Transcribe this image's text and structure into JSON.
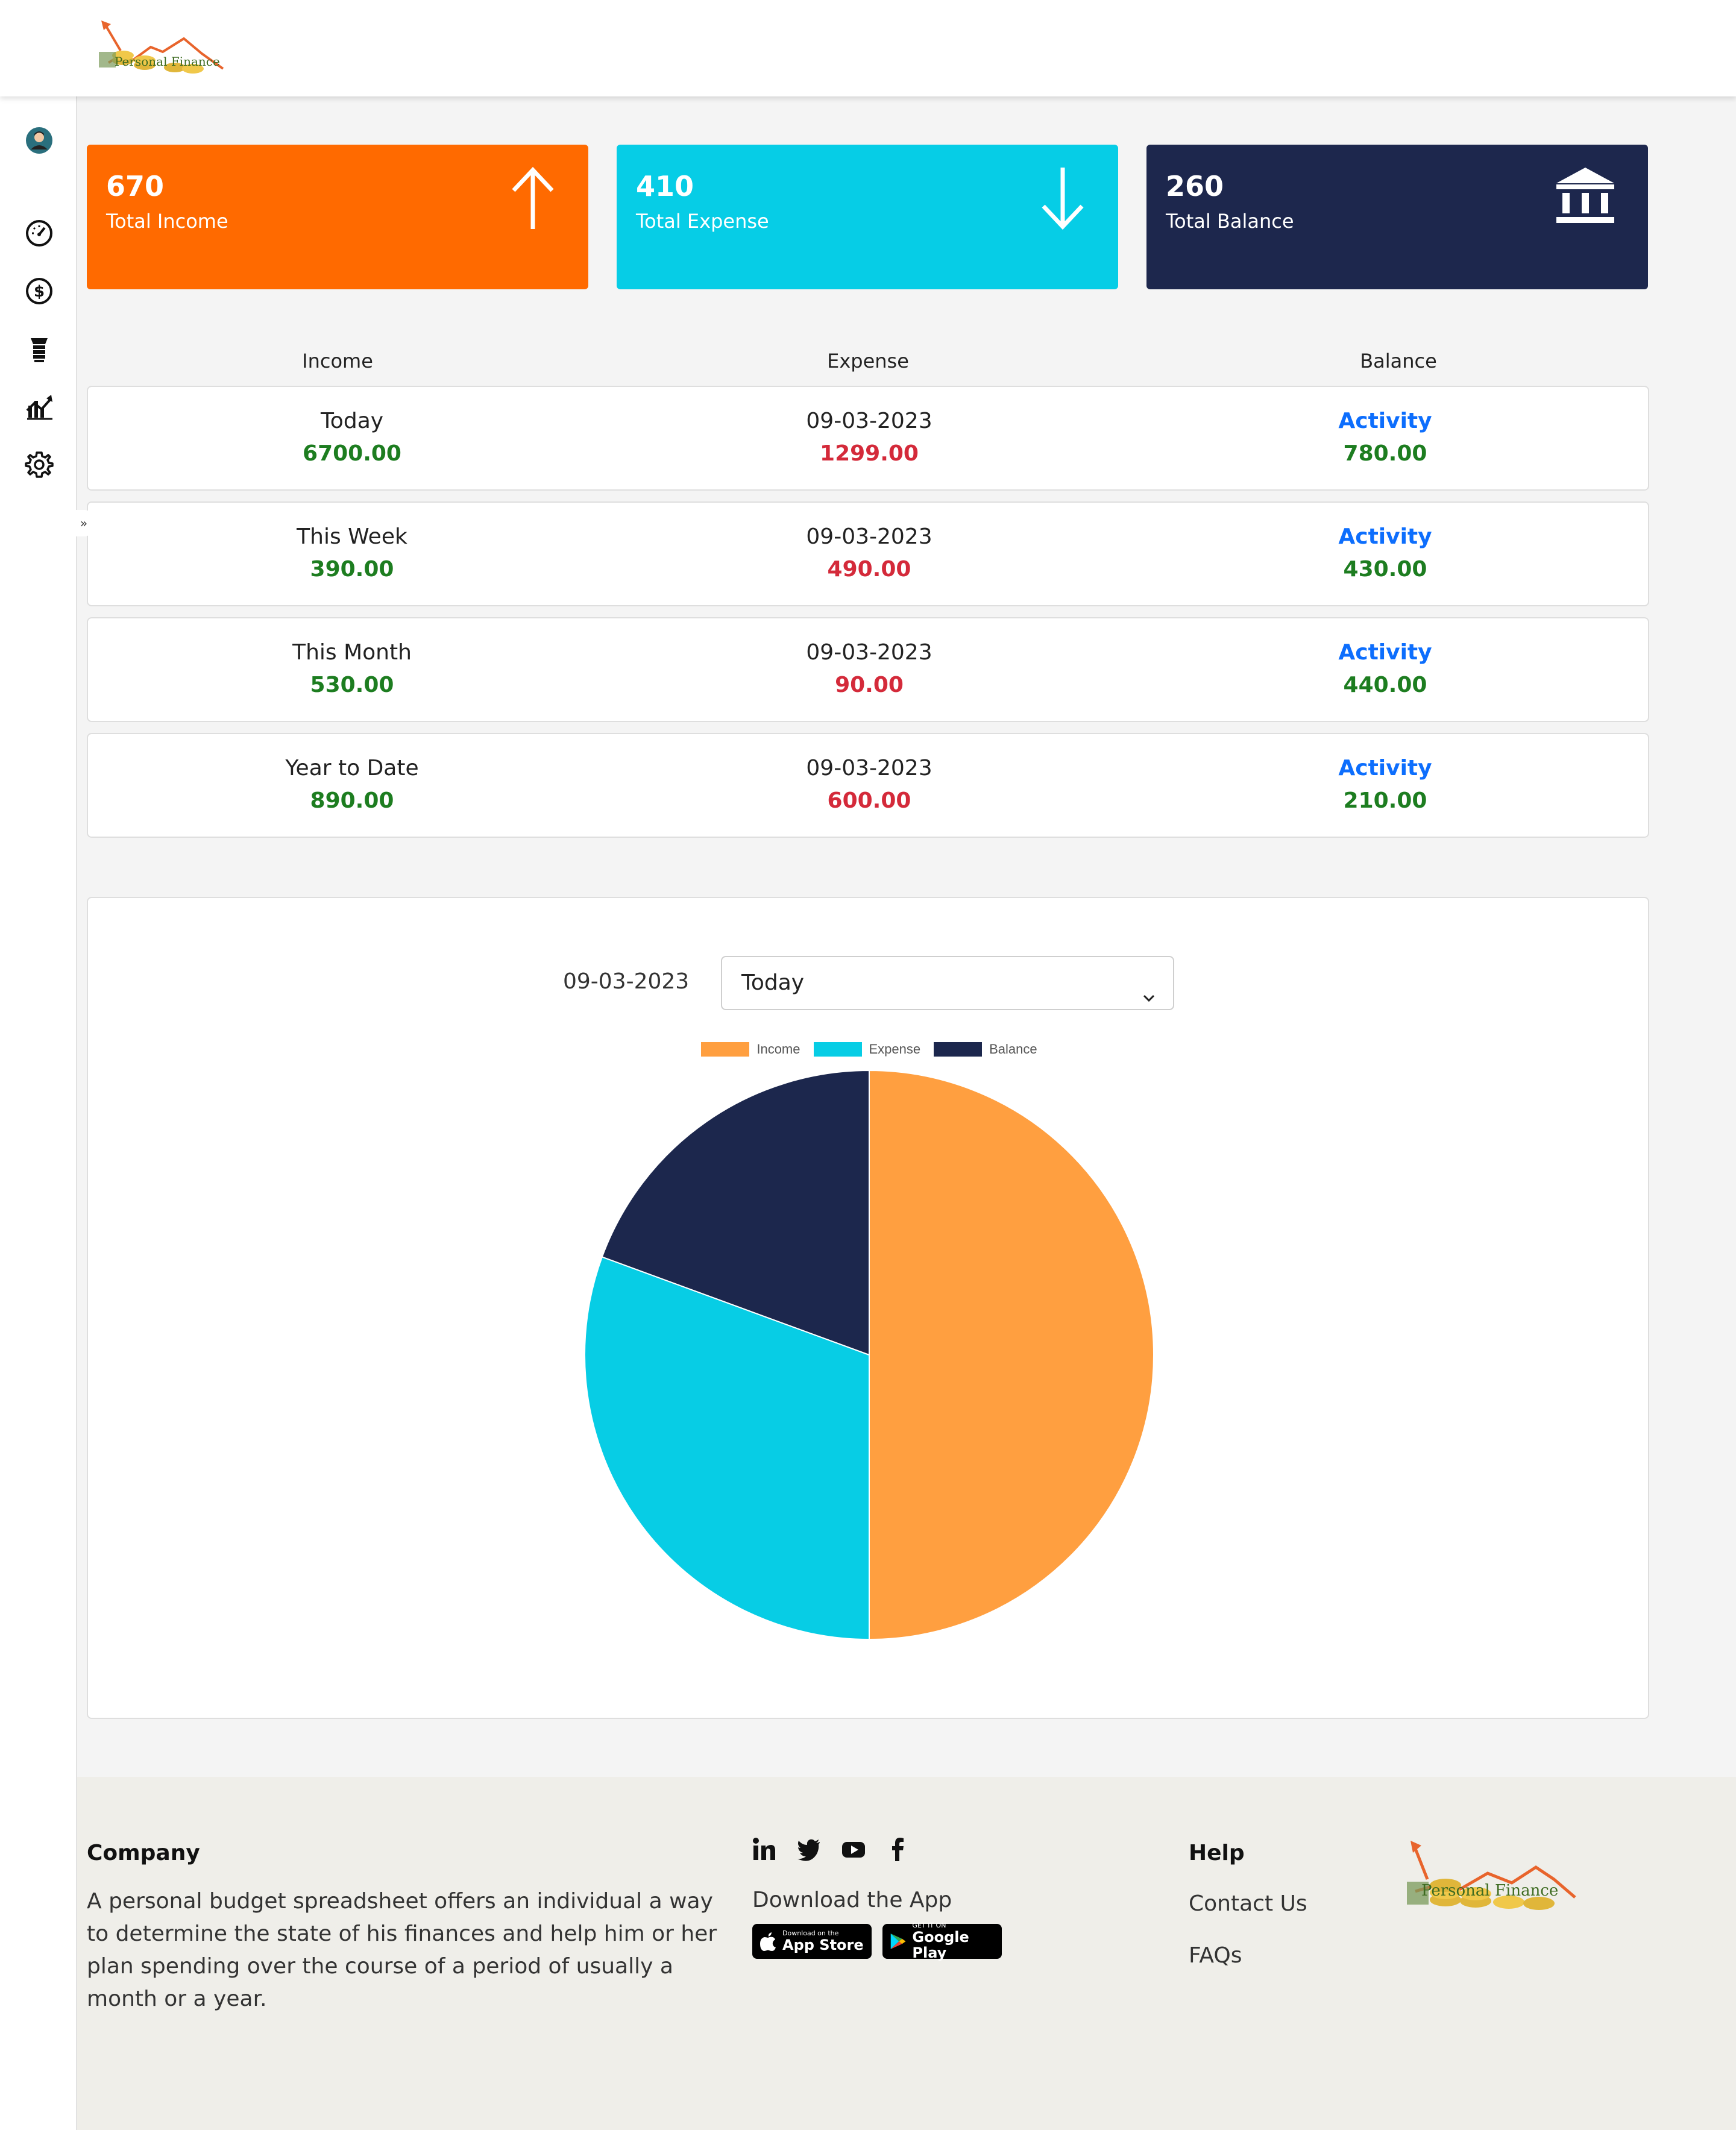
{
  "brand": {
    "logo_text": "Personal Finance"
  },
  "sidebar": {
    "items": [
      {
        "icon": "avatar"
      },
      {
        "icon": "dashboard-gauge-icon"
      },
      {
        "icon": "dollar-circle-icon"
      },
      {
        "icon": "money-stack-icon"
      },
      {
        "icon": "chart-icon"
      },
      {
        "icon": "gear-icon"
      }
    ],
    "toggle_label": "»"
  },
  "summary_cards": [
    {
      "value": "670",
      "label": "Total Income",
      "color": "#ff6a00",
      "icon": "arrow-up-icon"
    },
    {
      "value": "410",
      "label": "Total Expense",
      "color": "#06cde6",
      "icon": "arrow-down-icon"
    },
    {
      "value": "260",
      "label": "Total Balance",
      "color": "#1d274d",
      "icon": "bank-icon"
    }
  ],
  "table": {
    "headers": [
      "Income",
      "Expense",
      "Balance"
    ],
    "rows": [
      {
        "period": "Today",
        "income": "6700.00",
        "date": "09-03-2023",
        "expense": "1299.00",
        "activity": "Activity",
        "balance": "780.00"
      },
      {
        "period": "This Week",
        "income": "390.00",
        "date": "09-03-2023",
        "expense": "490.00",
        "activity": "Activity",
        "balance": "430.00"
      },
      {
        "period": "This Month",
        "income": "530.00",
        "date": "09-03-2023",
        "expense": "90.00",
        "activity": "Activity",
        "balance": "440.00"
      },
      {
        "period": "Year to Date",
        "income": "890.00",
        "date": "09-03-2023",
        "expense": "600.00",
        "activity": "Activity",
        "balance": "210.00"
      }
    ]
  },
  "chart_panel": {
    "date": "09-03-2023",
    "period_select": "Today"
  },
  "chart_data": {
    "type": "pie",
    "labels": [
      "Income",
      "Expense",
      "Balance"
    ],
    "values": [
      670,
      410,
      260
    ],
    "colors": [
      "#ff9f40",
      "#07cde5",
      "#1c274d"
    ],
    "legend": "top"
  },
  "footer": {
    "company_heading": "Company",
    "company_desc": "A personal budget spreadsheet offers an individual a way to determine the state of his finances and help him or her plan spending over the course of a period of usually a month or a year.",
    "socials": [
      "linkedin-icon",
      "twitter-icon",
      "youtube-icon",
      "facebook-icon"
    ],
    "download_label": "Download the App",
    "app_store": {
      "small": "Download on the",
      "big": "App Store"
    },
    "google_play": {
      "small": "GET IT ON",
      "big": "Google Play"
    },
    "help_heading": "Help",
    "help_links": [
      "Contact Us",
      "FAQs"
    ]
  }
}
